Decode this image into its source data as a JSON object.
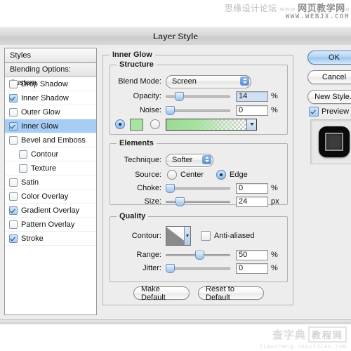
{
  "watermark_top": {
    "cn": "思缘设计论坛",
    "www": "www.",
    "site": "网页教学网",
    "suffix": "M",
    "url": "WWW.WEBJX.COM"
  },
  "watermark_bottom": {
    "cn": "查字典",
    "boxed": "教程网",
    "url": "jiaocheng.chazidian.com"
  },
  "titlebar": {
    "title": "Layer Style"
  },
  "sidebar": {
    "header": "Styles",
    "blending": "Blending Options: Custom",
    "items": [
      {
        "label": "Drop Shadow",
        "checked": false,
        "selected": false,
        "indent": false
      },
      {
        "label": "Inner Shadow",
        "checked": true,
        "selected": false,
        "indent": false
      },
      {
        "label": "Outer Glow",
        "checked": false,
        "selected": false,
        "indent": false
      },
      {
        "label": "Inner Glow",
        "checked": true,
        "selected": true,
        "indent": false
      },
      {
        "label": "Bevel and Emboss",
        "checked": false,
        "selected": false,
        "indent": false
      },
      {
        "label": "Contour",
        "checked": false,
        "selected": false,
        "indent": true
      },
      {
        "label": "Texture",
        "checked": false,
        "selected": false,
        "indent": true
      },
      {
        "label": "Satin",
        "checked": false,
        "selected": false,
        "indent": false
      },
      {
        "label": "Color Overlay",
        "checked": false,
        "selected": false,
        "indent": false
      },
      {
        "label": "Gradient Overlay",
        "checked": true,
        "selected": false,
        "indent": false
      },
      {
        "label": "Pattern Overlay",
        "checked": false,
        "selected": false,
        "indent": false
      },
      {
        "label": "Stroke",
        "checked": true,
        "selected": false,
        "indent": false
      }
    ]
  },
  "panel": {
    "title": "Inner Glow",
    "structure": {
      "legend": "Structure",
      "blend_mode_label": "Blend Mode:",
      "blend_mode_value": "Screen",
      "opacity_label": "Opacity:",
      "opacity_value": "14",
      "opacity_unit": "%",
      "noise_label": "Noise:",
      "noise_value": "0",
      "noise_unit": "%",
      "fill_color_selected": true,
      "fill_gradient_selected": false,
      "color_swatch": "#a8e3a1",
      "gradient_color": "#9ada92"
    },
    "elements": {
      "legend": "Elements",
      "technique_label": "Technique:",
      "technique_value": "Softer",
      "source_label": "Source:",
      "source_center": "Center",
      "source_edge": "Edge",
      "source_value": "Edge",
      "choke_label": "Choke:",
      "choke_value": "0",
      "choke_unit": "%",
      "size_label": "Size:",
      "size_value": "24",
      "size_unit": "px"
    },
    "quality": {
      "legend": "Quality",
      "contour_label": "Contour:",
      "anti_aliased_label": "Anti-aliased",
      "anti_aliased_checked": false,
      "range_label": "Range:",
      "range_value": "50",
      "range_unit": "%",
      "jitter_label": "Jitter:",
      "jitter_value": "0",
      "jitter_unit": "%"
    },
    "buttons": {
      "make_default": "Make Default",
      "reset_to_default": "Reset to Default"
    }
  },
  "actions": {
    "ok": "OK",
    "cancel": "Cancel",
    "new_style": "New Style..",
    "preview_label": "Preview",
    "preview_checked": true
  },
  "colors": {
    "accent": "#a8cdf5",
    "dialog_bg": "#ededed",
    "glow_green": "#a8e3a1"
  }
}
